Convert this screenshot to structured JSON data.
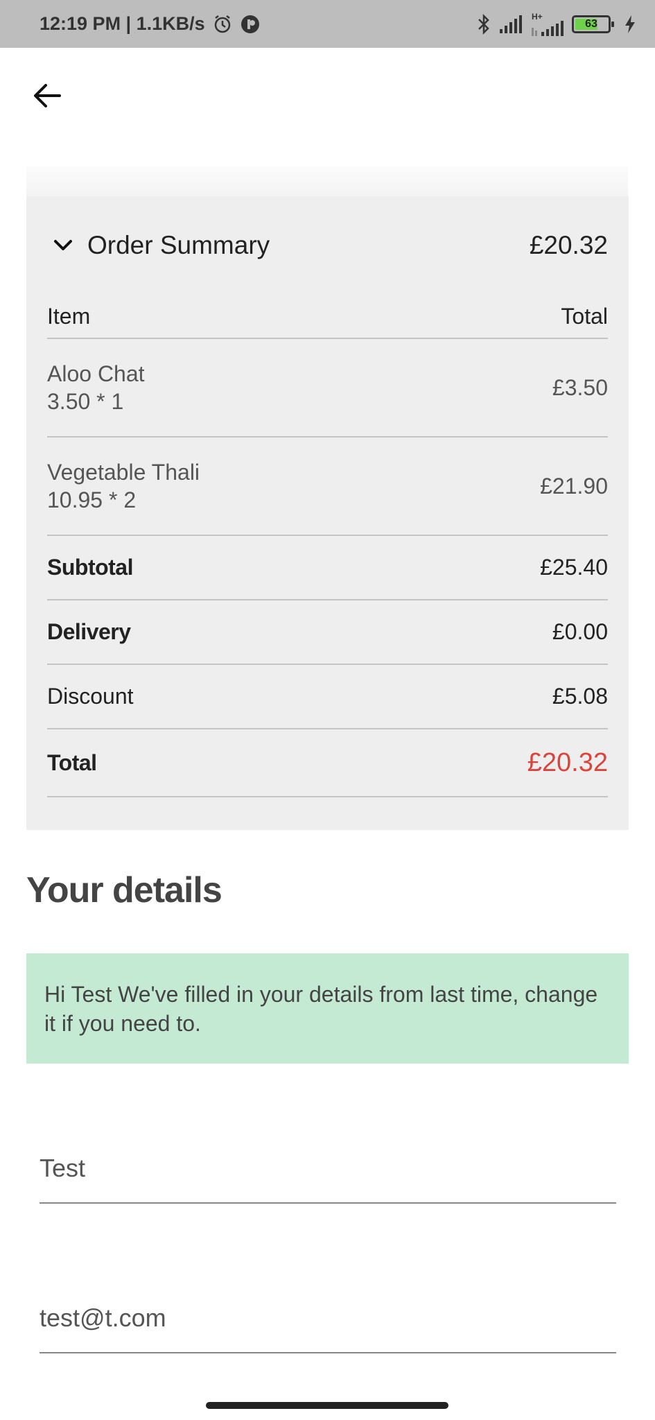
{
  "status_bar": {
    "time_speed": "12:19 PM | 1.1KB/s",
    "network_label": "H+",
    "battery": "63",
    "icons": [
      "alarm-icon",
      "app-notification-icon",
      "bluetooth-icon",
      "signal-icon",
      "signal-icon",
      "battery-icon",
      "charging-icon"
    ]
  },
  "nav": {
    "back_icon": "arrow-left-icon"
  },
  "order_summary": {
    "title": "Order Summary",
    "amount": "£20.32",
    "col_item": "Item",
    "col_total": "Total",
    "items": [
      {
        "name": "Aloo Chat",
        "qty": "3.50 * 1",
        "price": "£3.50"
      },
      {
        "name": "Vegetable Thali",
        "qty": "10.95 * 2",
        "price": "£21.90"
      }
    ],
    "subtotal_label": "Subtotal",
    "subtotal_value": "£25.40",
    "delivery_label": "Delivery",
    "delivery_value": "£0.00",
    "discount_label": "Discount",
    "discount_value": "£5.08",
    "total_label": "Total",
    "total_value": "£20.32",
    "colors": {
      "total_accent": "#d9443b",
      "panel_bg": "#eeeeee"
    }
  },
  "details": {
    "title": "Your details",
    "notice": "Hi Test We've filled in your details from last time, change it if you need to.",
    "notice_bg": "#c4ead3",
    "name_value": "Test",
    "email_value": "test@t.com"
  }
}
